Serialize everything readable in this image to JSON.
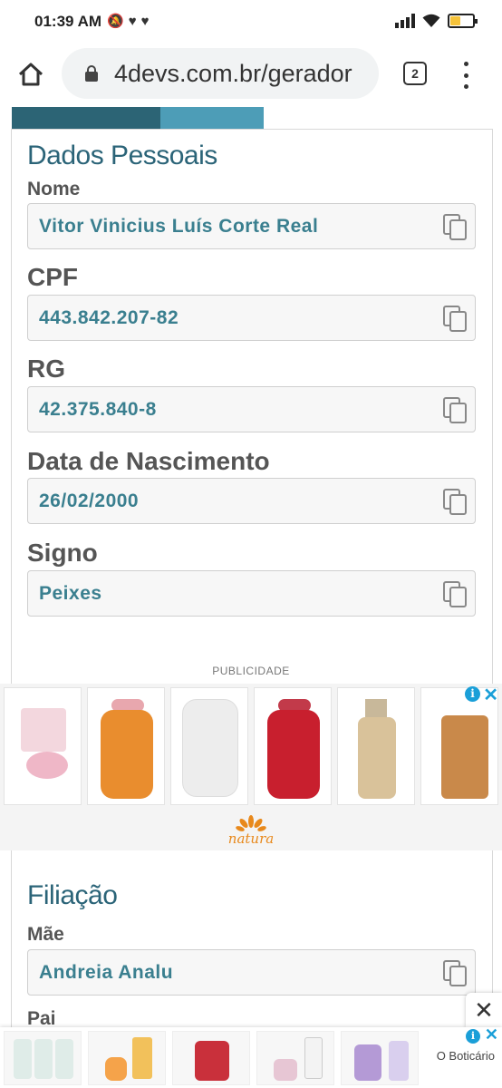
{
  "status_bar": {
    "time": "01:39 AM",
    "notification_icons": [
      "mute-icon",
      "heart-icon",
      "heart-icon"
    ],
    "battery_color": "#f6c33a"
  },
  "browser": {
    "url": "4devs.com.br/gerador",
    "tab_count": "2"
  },
  "dados_pessoais": {
    "title": "Dados Pessoais",
    "fields": [
      {
        "label": "Nome",
        "value": "Vitor Vinicius Luís Corte Real"
      },
      {
        "label": "CPF",
        "value": "443.842.207-82"
      },
      {
        "label": "RG",
        "value": "42.375.840-8"
      },
      {
        "label": "Data de Nascimento",
        "value": "26/02/2000"
      },
      {
        "label": "Signo",
        "value": "Peixes"
      }
    ]
  },
  "ad": {
    "label": "PUBLICIDADE",
    "brand": "natura",
    "info_icon": "i",
    "close_icon": "✕"
  },
  "filiacao": {
    "title": "Filiação",
    "fields": [
      {
        "label": "Mãe",
        "value": "Andreia Analu"
      },
      {
        "label": "Pai",
        "value": ""
      }
    ]
  },
  "bottom_ad": {
    "brand": "O Boticário",
    "close_icon": "✕"
  },
  "colors": {
    "accent": "#2b6478",
    "value_text": "#3a7f8f",
    "tab_dark": "#2c6475",
    "tab_light": "#4d9db7"
  }
}
